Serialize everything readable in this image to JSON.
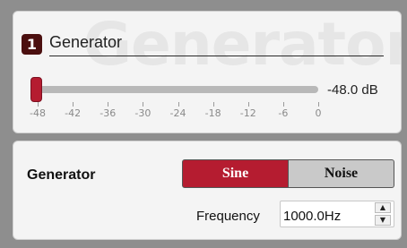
{
  "header": {
    "watermark": "Generator",
    "channel_number": "1",
    "channel_name": "Generator"
  },
  "level": {
    "readout": "-48.0 dB",
    "value_db": -48.0,
    "min_db": -48,
    "max_db": 0,
    "ticks": [
      "-48",
      "-42",
      "-36",
      "-30",
      "-24",
      "-18",
      "-12",
      "-6",
      "0"
    ]
  },
  "generator": {
    "label": "Generator",
    "modes": [
      "Sine",
      "Noise"
    ],
    "selected_mode": "Sine",
    "frequency_label": "Frequency",
    "frequency_value": "1000.0Hz"
  },
  "colors": {
    "accent": "#b51c30",
    "badge": "#4b0f0f",
    "background": "#8e8e8e",
    "panel": "#f4f4f4"
  },
  "icons": {
    "spinner_up": "up-arrow-icon",
    "spinner_down": "down-arrow-icon"
  }
}
